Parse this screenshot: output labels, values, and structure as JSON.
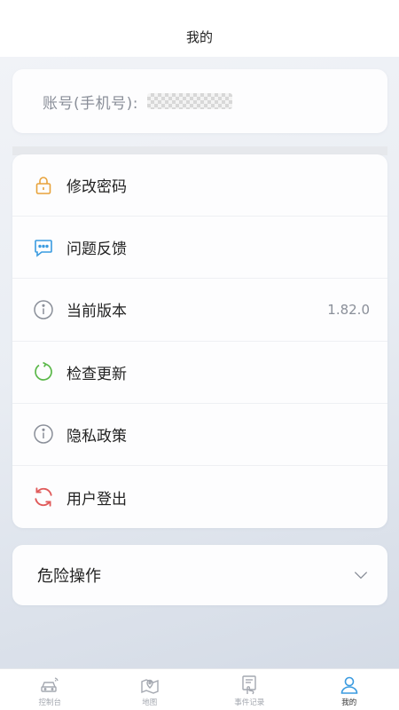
{
  "header": {
    "title": "我的"
  },
  "account": {
    "label": "账号(手机号):"
  },
  "menu": {
    "items": [
      {
        "label": "修改密码",
        "icon": "lock-icon",
        "color": "#e8a23a"
      },
      {
        "label": "问题反馈",
        "icon": "chat-feedback-icon",
        "color": "#3a9be0"
      },
      {
        "label": "当前版本",
        "icon": "info-icon",
        "color": "#8a8f99",
        "value": "1.82.0"
      },
      {
        "label": "检查更新",
        "icon": "refresh-icon",
        "color": "#5bb84a"
      },
      {
        "label": "隐私政策",
        "icon": "info-icon",
        "color": "#8a8f99"
      },
      {
        "label": "用户登出",
        "icon": "logout-sync-icon",
        "color": "#e05a5a"
      }
    ]
  },
  "danger": {
    "label": "危险操作"
  },
  "tabs": [
    {
      "label": "控制台",
      "icon": "car-icon",
      "active": false
    },
    {
      "label": "地图",
      "icon": "map-icon",
      "active": false
    },
    {
      "label": "事件记录",
      "icon": "event-record-icon",
      "active": false
    },
    {
      "label": "我的",
      "icon": "profile-icon",
      "active": true
    }
  ],
  "colors": {
    "active_tab": "#3a9be0",
    "inactive_tab": "#a4a8b0"
  }
}
